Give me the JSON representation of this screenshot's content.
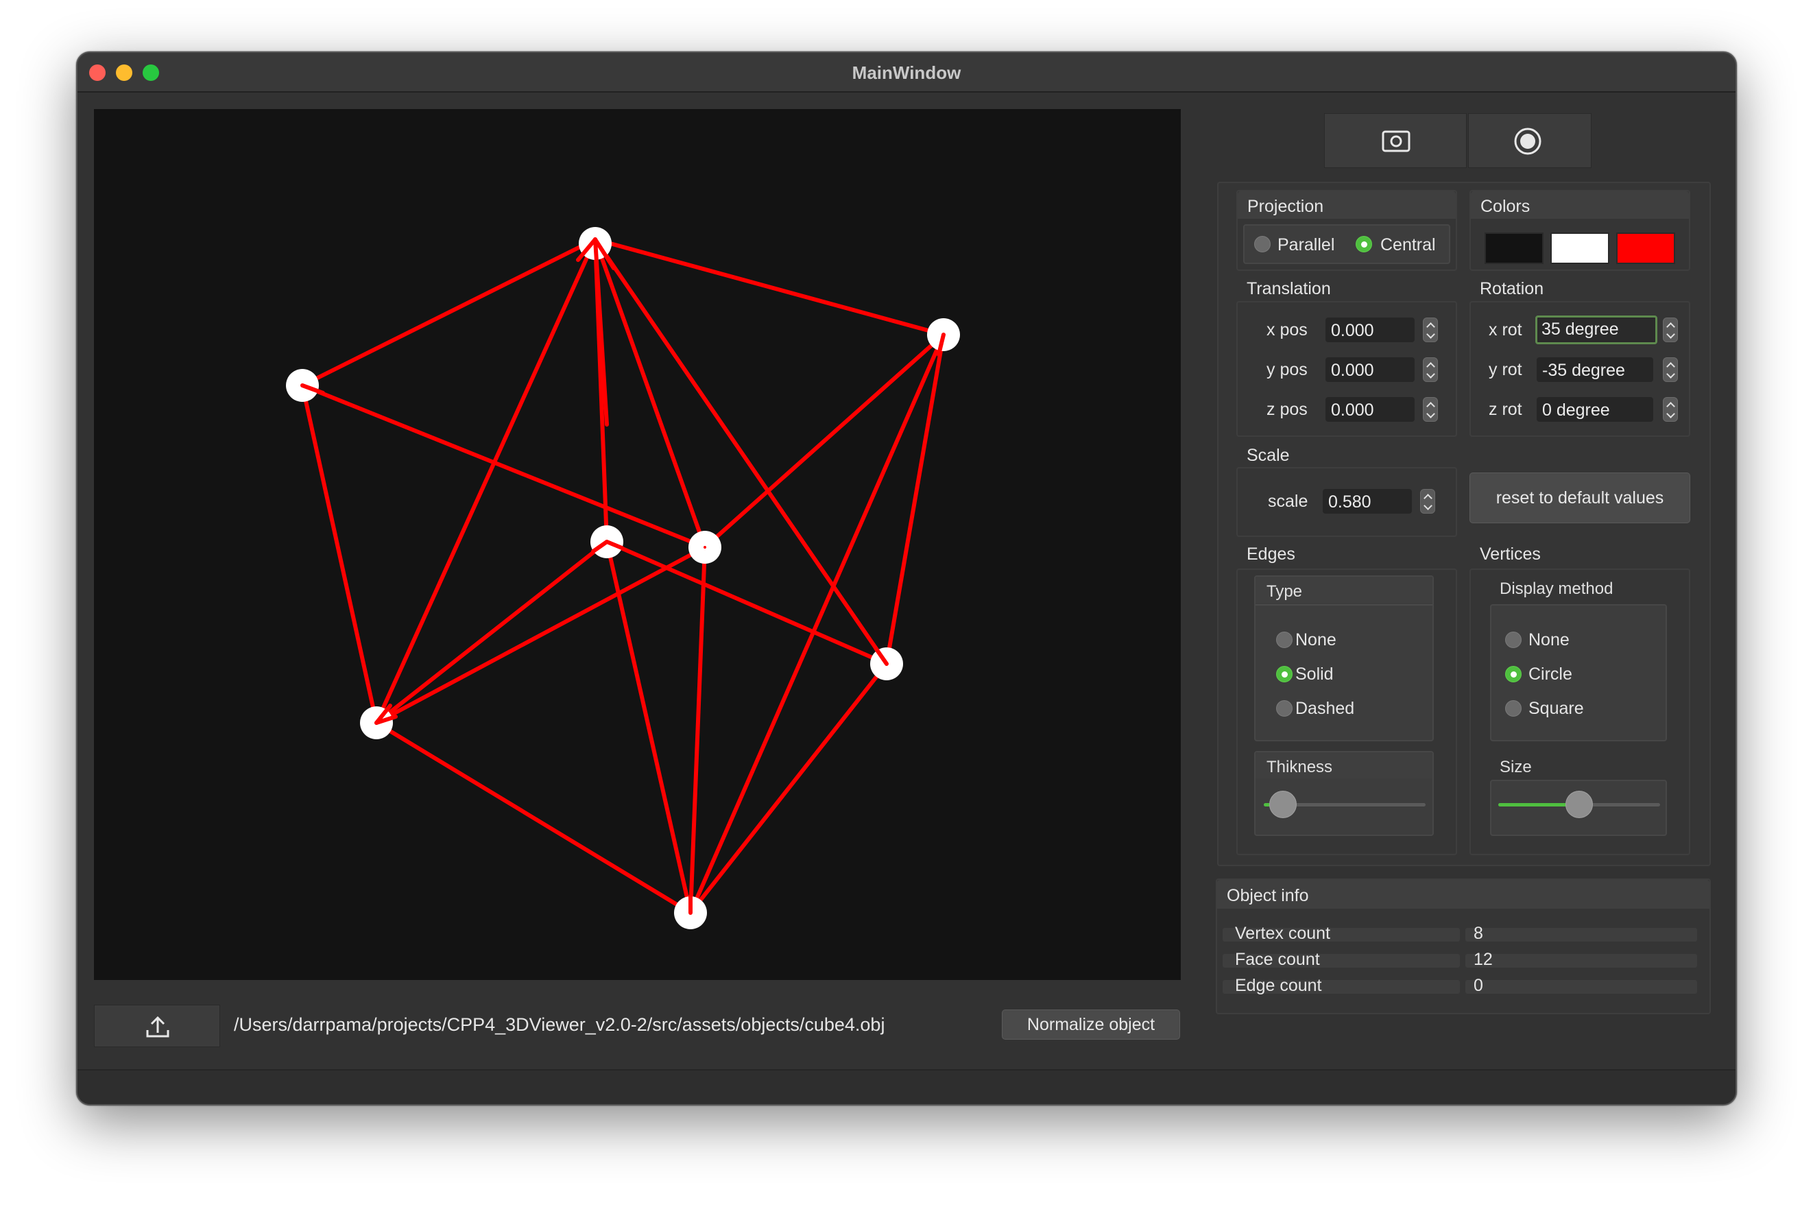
{
  "window": {
    "title": "MainWindow",
    "traffic_lights": {
      "close": "#ff5f57",
      "minimize": "#febc2e",
      "zoom": "#28c840"
    }
  },
  "toolbar": {
    "screenshot_icon": "camera-screenshot-icon",
    "record_icon": "record-icon"
  },
  "projection": {
    "title": "Projection",
    "options": [
      "Parallel",
      "Central"
    ],
    "selected": "Central"
  },
  "colors": {
    "title": "Colors",
    "swatches": [
      "#131313",
      "#ffffff",
      "#ff0000"
    ]
  },
  "translation": {
    "title": "Translation",
    "x_label": "x pos",
    "x_value": "0.000",
    "y_label": "y pos",
    "y_value": "0.000",
    "z_label": "z pos",
    "z_value": "0.000"
  },
  "rotation": {
    "title": "Rotation",
    "x_label": "x rot",
    "x_value": "35 degree",
    "y_label": "y rot",
    "y_value": "-35 degree",
    "z_label": "z rot",
    "z_value": "0 degree"
  },
  "scale": {
    "title": "Scale",
    "label": "scale",
    "value": "0.580"
  },
  "reset_button": "reset to default values",
  "edges": {
    "title": "Edges",
    "type_title": "Type",
    "options": [
      "None",
      "Solid",
      "Dashed"
    ],
    "selected": "Solid",
    "thickness_title": "Thikness",
    "thickness_level": 0.12
  },
  "vertices": {
    "title": "Vertices",
    "method_title": "Display method",
    "options": [
      "None",
      "Circle",
      "Square"
    ],
    "selected": "Circle",
    "size_title": "Size",
    "size_level": 0.5
  },
  "object_info": {
    "title": "Object info",
    "vertex_label": "Vertex count",
    "vertex_value": "8",
    "face_label": "Face count",
    "face_value": "12",
    "edge_label": "Edge count",
    "edge_value": "0"
  },
  "bottom": {
    "upload_icon": "upload-icon",
    "file_path": "/Users/darrpama/projects/CPP4_3DViewer_v2.0-2/src/assets/objects/cube4.obj",
    "normalize_button": "Normalize object"
  },
  "scene": {
    "edge_color": "#ff0000",
    "vertex_color": "#ffffff",
    "background": "#131313"
  }
}
